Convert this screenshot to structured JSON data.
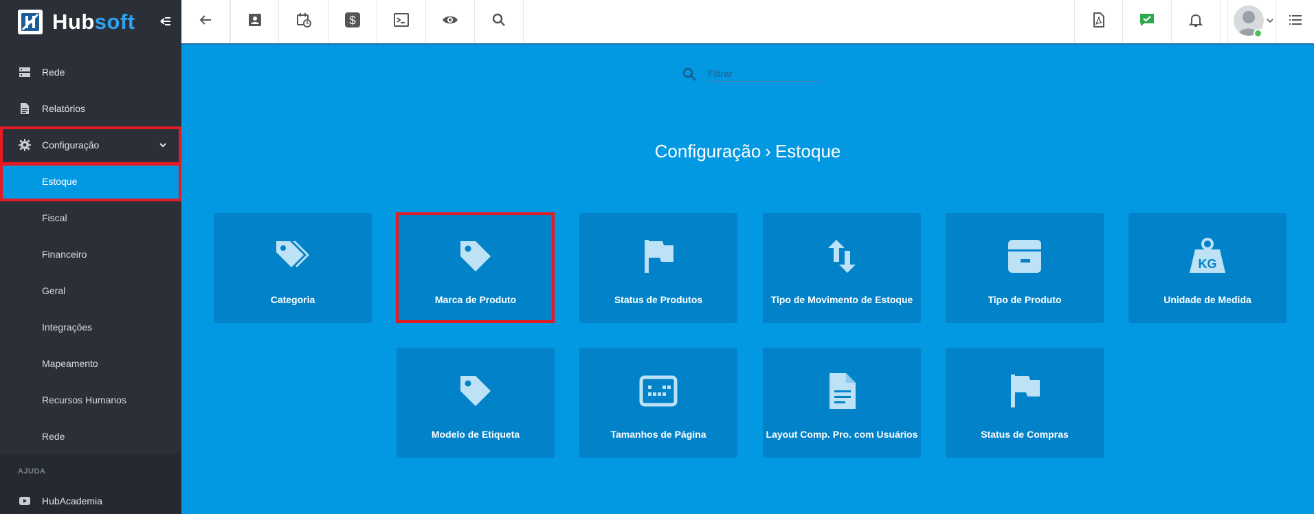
{
  "brand": {
    "name_part1": "Hub",
    "name_part2": "soft"
  },
  "sidebar": {
    "items": [
      {
        "label": "Rede",
        "icon": "server-icon"
      },
      {
        "label": "Relatórios",
        "icon": "document-icon"
      },
      {
        "label": "Configuração",
        "icon": "gear-icon",
        "expanded": true
      },
      {
        "label": "Estoque",
        "active": true
      },
      {
        "label": "Fiscal"
      },
      {
        "label": "Financeiro"
      },
      {
        "label": "Geral"
      },
      {
        "label": "Integrações"
      },
      {
        "label": "Mapeamento"
      },
      {
        "label": "Recursos Humanos"
      },
      {
        "label": "Rede"
      }
    ],
    "help_section": {
      "title": "AJUDA",
      "item": "HubAcademia"
    }
  },
  "topbar": {
    "left_icons": [
      "back-arrow-icon",
      "contact-card-icon",
      "calendar-clock-icon",
      "dollar-icon",
      "terminal-icon",
      "eye-icon",
      "search-icon"
    ],
    "right_icons": [
      "pdf-icon",
      "chat-check-icon",
      "bell-icon",
      "user-avatar",
      "menu-list-icon"
    ]
  },
  "filter": {
    "placeholder": "Filtrar"
  },
  "breadcrumb": {
    "parent": "Configuração",
    "separator": "›",
    "current": "Estoque"
  },
  "cards": [
    {
      "label": "Categoria",
      "icon": "tags-icon"
    },
    {
      "label": "Marca de Produto",
      "icon": "tag-icon",
      "highlighted": true
    },
    {
      "label": "Status de Produtos",
      "icon": "flag-icon"
    },
    {
      "label": "Tipo de Movimento de Estoque",
      "icon": "swap-vertical-icon"
    },
    {
      "label": "Tipo de Produto",
      "icon": "box-icon"
    },
    {
      "label": "Unidade de Medida",
      "icon": "weight-kg-icon",
      "icon_text": "KG"
    },
    {
      "label": "Modelo de Etiqueta",
      "icon": "tag-icon"
    },
    {
      "label": "Tamanhos de Página",
      "icon": "page-size-icon"
    },
    {
      "label": "Layout Comp. Pro. com Usuários",
      "icon": "file-text-icon"
    },
    {
      "label": "Status de Compras",
      "icon": "flag-icon"
    }
  ],
  "colors": {
    "accent": "#0399e2",
    "sidebar_bg": "#2b3038",
    "card_bg": "#0282c9",
    "highlight": "#e41b23"
  }
}
